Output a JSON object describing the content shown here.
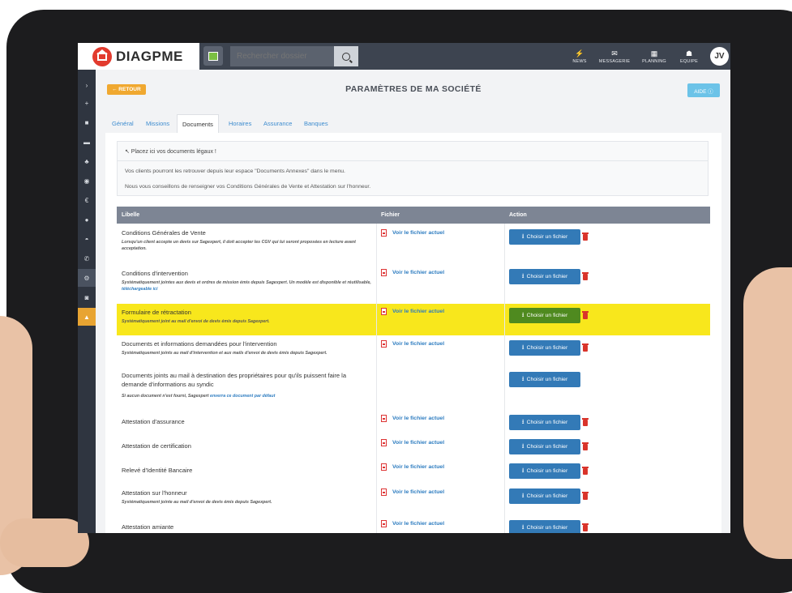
{
  "app": {
    "logo_text": "DIAGPME",
    "avatar": "JV"
  },
  "search": {
    "placeholder": "Rechercher dossier"
  },
  "nav": [
    {
      "label": "NEWS",
      "icon": "lightning-icon"
    },
    {
      "label": "MESSAGERIE",
      "icon": "envelope-icon"
    },
    {
      "label": "PLANNING",
      "icon": "calendar-icon"
    },
    {
      "label": "EQUIPE",
      "icon": "team-icon"
    }
  ],
  "page": {
    "retour": "← RETOUR",
    "title": "PARAMÈTRES DE MA SOCIÉTÉ",
    "aide": "AIDE ⓘ"
  },
  "tabs": [
    "Général",
    "Missions",
    "Documents",
    "Horaires",
    "Assurance",
    "Banques"
  ],
  "active_tab": "Documents",
  "info": {
    "head": "↖ Placez ici vos documents légaux !",
    "line1": "Vos clients pourront les retrouver depuis leur espace \"Documents Annexes\" dans le menu.",
    "line2": "Nous vous conseillons de renseigner vos Conditions Générales de Vente et Attestation sur l'honneur."
  },
  "table": {
    "headers": {
      "libelle": "Libelle",
      "fichier": "Fichier",
      "action": "Action"
    },
    "file_link": "Voir le fichier actuel",
    "choose_label": "Choisir un fichier",
    "rows": [
      {
        "title": "Conditions Générales de Vente",
        "desc": "Lorsqu'un client accepte un devis sur Sagexpert, il doit accepter les CGV qui lui seront proposées en lecture avant acceptation.",
        "desc_link": ""
      },
      {
        "title": "Conditions d'intervention",
        "desc": "Systématiquement jointes aux devis et ordres de mission émis depuis Sagexpert. Un modèle est disponible et réutilisable,",
        "desc_link": "téléchargeable ici"
      },
      {
        "title": "Formulaire de rétractation",
        "desc": "Systématiquement joint au mail d'envoi de devis émis depuis Sagexpert.",
        "desc_link": ""
      },
      {
        "title": "Documents et informations demandées pour l'intervention",
        "desc": "Systématiquement joints au mail d'intervention et aux mails d'envoi de devis émis depuis Sagexpert.",
        "desc_link": ""
      },
      {
        "title": "Documents joints au mail à destination des propriétaires pour qu'ils puissent faire la demande d'informations au syndic",
        "desc": "Si aucun document n'est fourni, Sagexpert",
        "desc_link": "enverra ce document par défaut"
      },
      {
        "title": "Attestation d'assurance",
        "desc": "",
        "desc_link": ""
      },
      {
        "title": "Attestation de certification",
        "desc": "",
        "desc_link": ""
      },
      {
        "title": "Relevé d'Identité Bancaire",
        "desc": "",
        "desc_link": ""
      },
      {
        "title": "Attestation sur l'honneur",
        "desc": "Systématiquement jointe au mail d'envoi de devis émis depuis Sagexpert.",
        "desc_link": ""
      },
      {
        "title": "Attestation amiante",
        "desc": "",
        "desc_link": ""
      }
    ]
  },
  "colors": {
    "topbar": "#3d4450",
    "sidebar": "#2f3540",
    "primary": "#337ab7",
    "highlight": "#f8e71c",
    "retour": "#f0a830",
    "success": "#4f8a1f"
  }
}
